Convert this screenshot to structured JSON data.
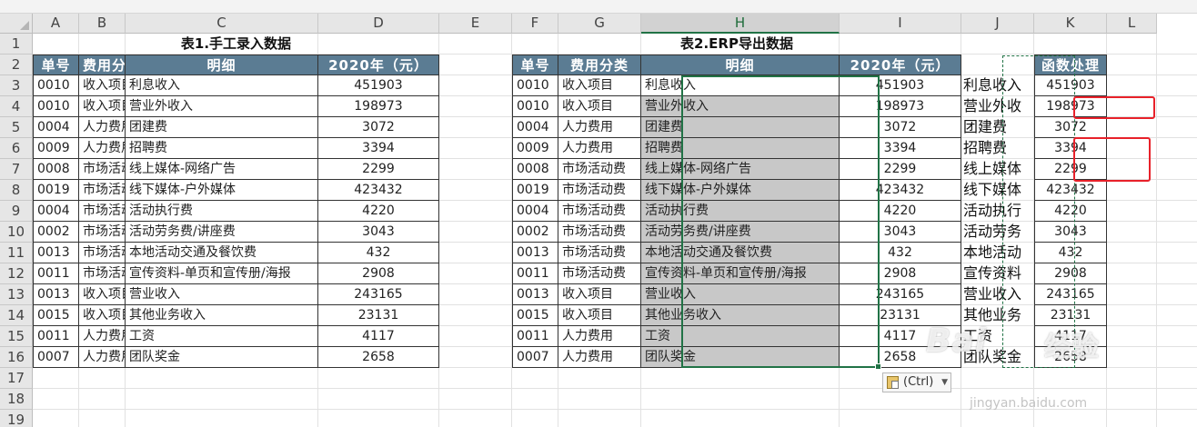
{
  "columns": [
    "A",
    "B",
    "C",
    "D",
    "E",
    "F",
    "G",
    "H",
    "I",
    "J",
    "K",
    "L"
  ],
  "rows": [
    "1",
    "2",
    "3",
    "4",
    "5",
    "6",
    "7",
    "8",
    "9",
    "10",
    "11",
    "12",
    "13",
    "14",
    "15",
    "16",
    "17",
    "18",
    "19"
  ],
  "selected_column": "H",
  "table1": {
    "title": "表1.手工录入数据",
    "headers": [
      "单号",
      "费用分类",
      "明细",
      "2020年（元）"
    ],
    "rows": [
      [
        "0010",
        "收入项目",
        "利息收入",
        "451903"
      ],
      [
        "0010",
        "收入项目",
        "营业外收入",
        "198973"
      ],
      [
        "0004",
        "人力费用",
        "团建费",
        "3072"
      ],
      [
        "0009",
        "人力费用",
        "招聘费",
        "3394"
      ],
      [
        "0008",
        "市场活动费",
        "线上媒体-网络广告",
        "2299"
      ],
      [
        "0019",
        "市场活动费",
        "线下媒体-户外媒体",
        "423432"
      ],
      [
        "0004",
        "市场活动费",
        "活动执行费",
        "4220"
      ],
      [
        "0002",
        "市场活动费",
        "活动劳务费/讲座费",
        "3043"
      ],
      [
        "0013",
        "市场活动费",
        "本地活动交通及餐饮费",
        "432"
      ],
      [
        "0011",
        "市场活动费",
        "宣传资料-单页和宣传册/海报",
        "2908"
      ],
      [
        "0013",
        "收入项目",
        "营业收入",
        "243165"
      ],
      [
        "0015",
        "收入项目",
        "其他业务收入",
        "23131"
      ],
      [
        "0011",
        "人力费用",
        "工资",
        "4117"
      ],
      [
        "0007",
        "人力费用",
        "团队奖金",
        "2658"
      ]
    ]
  },
  "table2": {
    "title": "表2.ERP导出数据",
    "headers": [
      "单号",
      "费用分类",
      "明细",
      "2020年（元）"
    ],
    "rows": [
      [
        "0010",
        "收入项目",
        "利息收入",
        "451903"
      ],
      [
        "0010",
        "收入项目",
        "营业外收入",
        "198973"
      ],
      [
        "0004",
        "人力费用",
        "团建费",
        "3072"
      ],
      [
        "0009",
        "人力费用",
        "招聘费",
        "3394"
      ],
      [
        "0008",
        "市场活动费",
        "线上媒体-网络广告",
        "2299"
      ],
      [
        "0019",
        "市场活动费",
        "线下媒体-户外媒体",
        "423432"
      ],
      [
        "0004",
        "市场活动费",
        "活动执行费",
        "4220"
      ],
      [
        "0002",
        "市场活动费",
        "活动劳务费/讲座费",
        "3043"
      ],
      [
        "0013",
        "市场活动费",
        "本地活动交通及餐饮费",
        "432"
      ],
      [
        "0011",
        "市场活动费",
        "宣传资料-单页和宣传册/海报",
        "2908"
      ],
      [
        "0013",
        "收入项目",
        "营业收入",
        "243165"
      ],
      [
        "0015",
        "收入项目",
        "其他业务收入",
        "23131"
      ],
      [
        "0011",
        "人力费用",
        "工资",
        "4117"
      ],
      [
        "0007",
        "人力费用",
        "团队奖金",
        "2658"
      ]
    ]
  },
  "col_j": [
    "利息收入",
    "营业外收",
    "团建费",
    "招聘费",
    "线上媒体",
    "线下媒体",
    "活动执行",
    "活动劳务",
    "本地活动",
    "宣传资料",
    "营业收入",
    "其他业务",
    "工资",
    "团队奖金"
  ],
  "col_k": {
    "header": "函数处理",
    "values": [
      "451903",
      "198973",
      "3072",
      "3394",
      "2299",
      "423432",
      "4220",
      "3043",
      "432",
      "2908",
      "243165",
      "23131",
      "4117",
      "2658"
    ]
  },
  "highlighted_k_values": [
    "198973",
    "3394",
    "2299"
  ],
  "paste_options": {
    "label": "(Ctrl)"
  },
  "watermark": {
    "text": "Bai",
    "text2": "经验",
    "url": "jingyan.baidu.com"
  },
  "colors": {
    "header_fill": "#5b7c93",
    "grey_fill": "#c8c8c8",
    "highlight_red": "#e8212a",
    "selection_green": "#217346"
  }
}
